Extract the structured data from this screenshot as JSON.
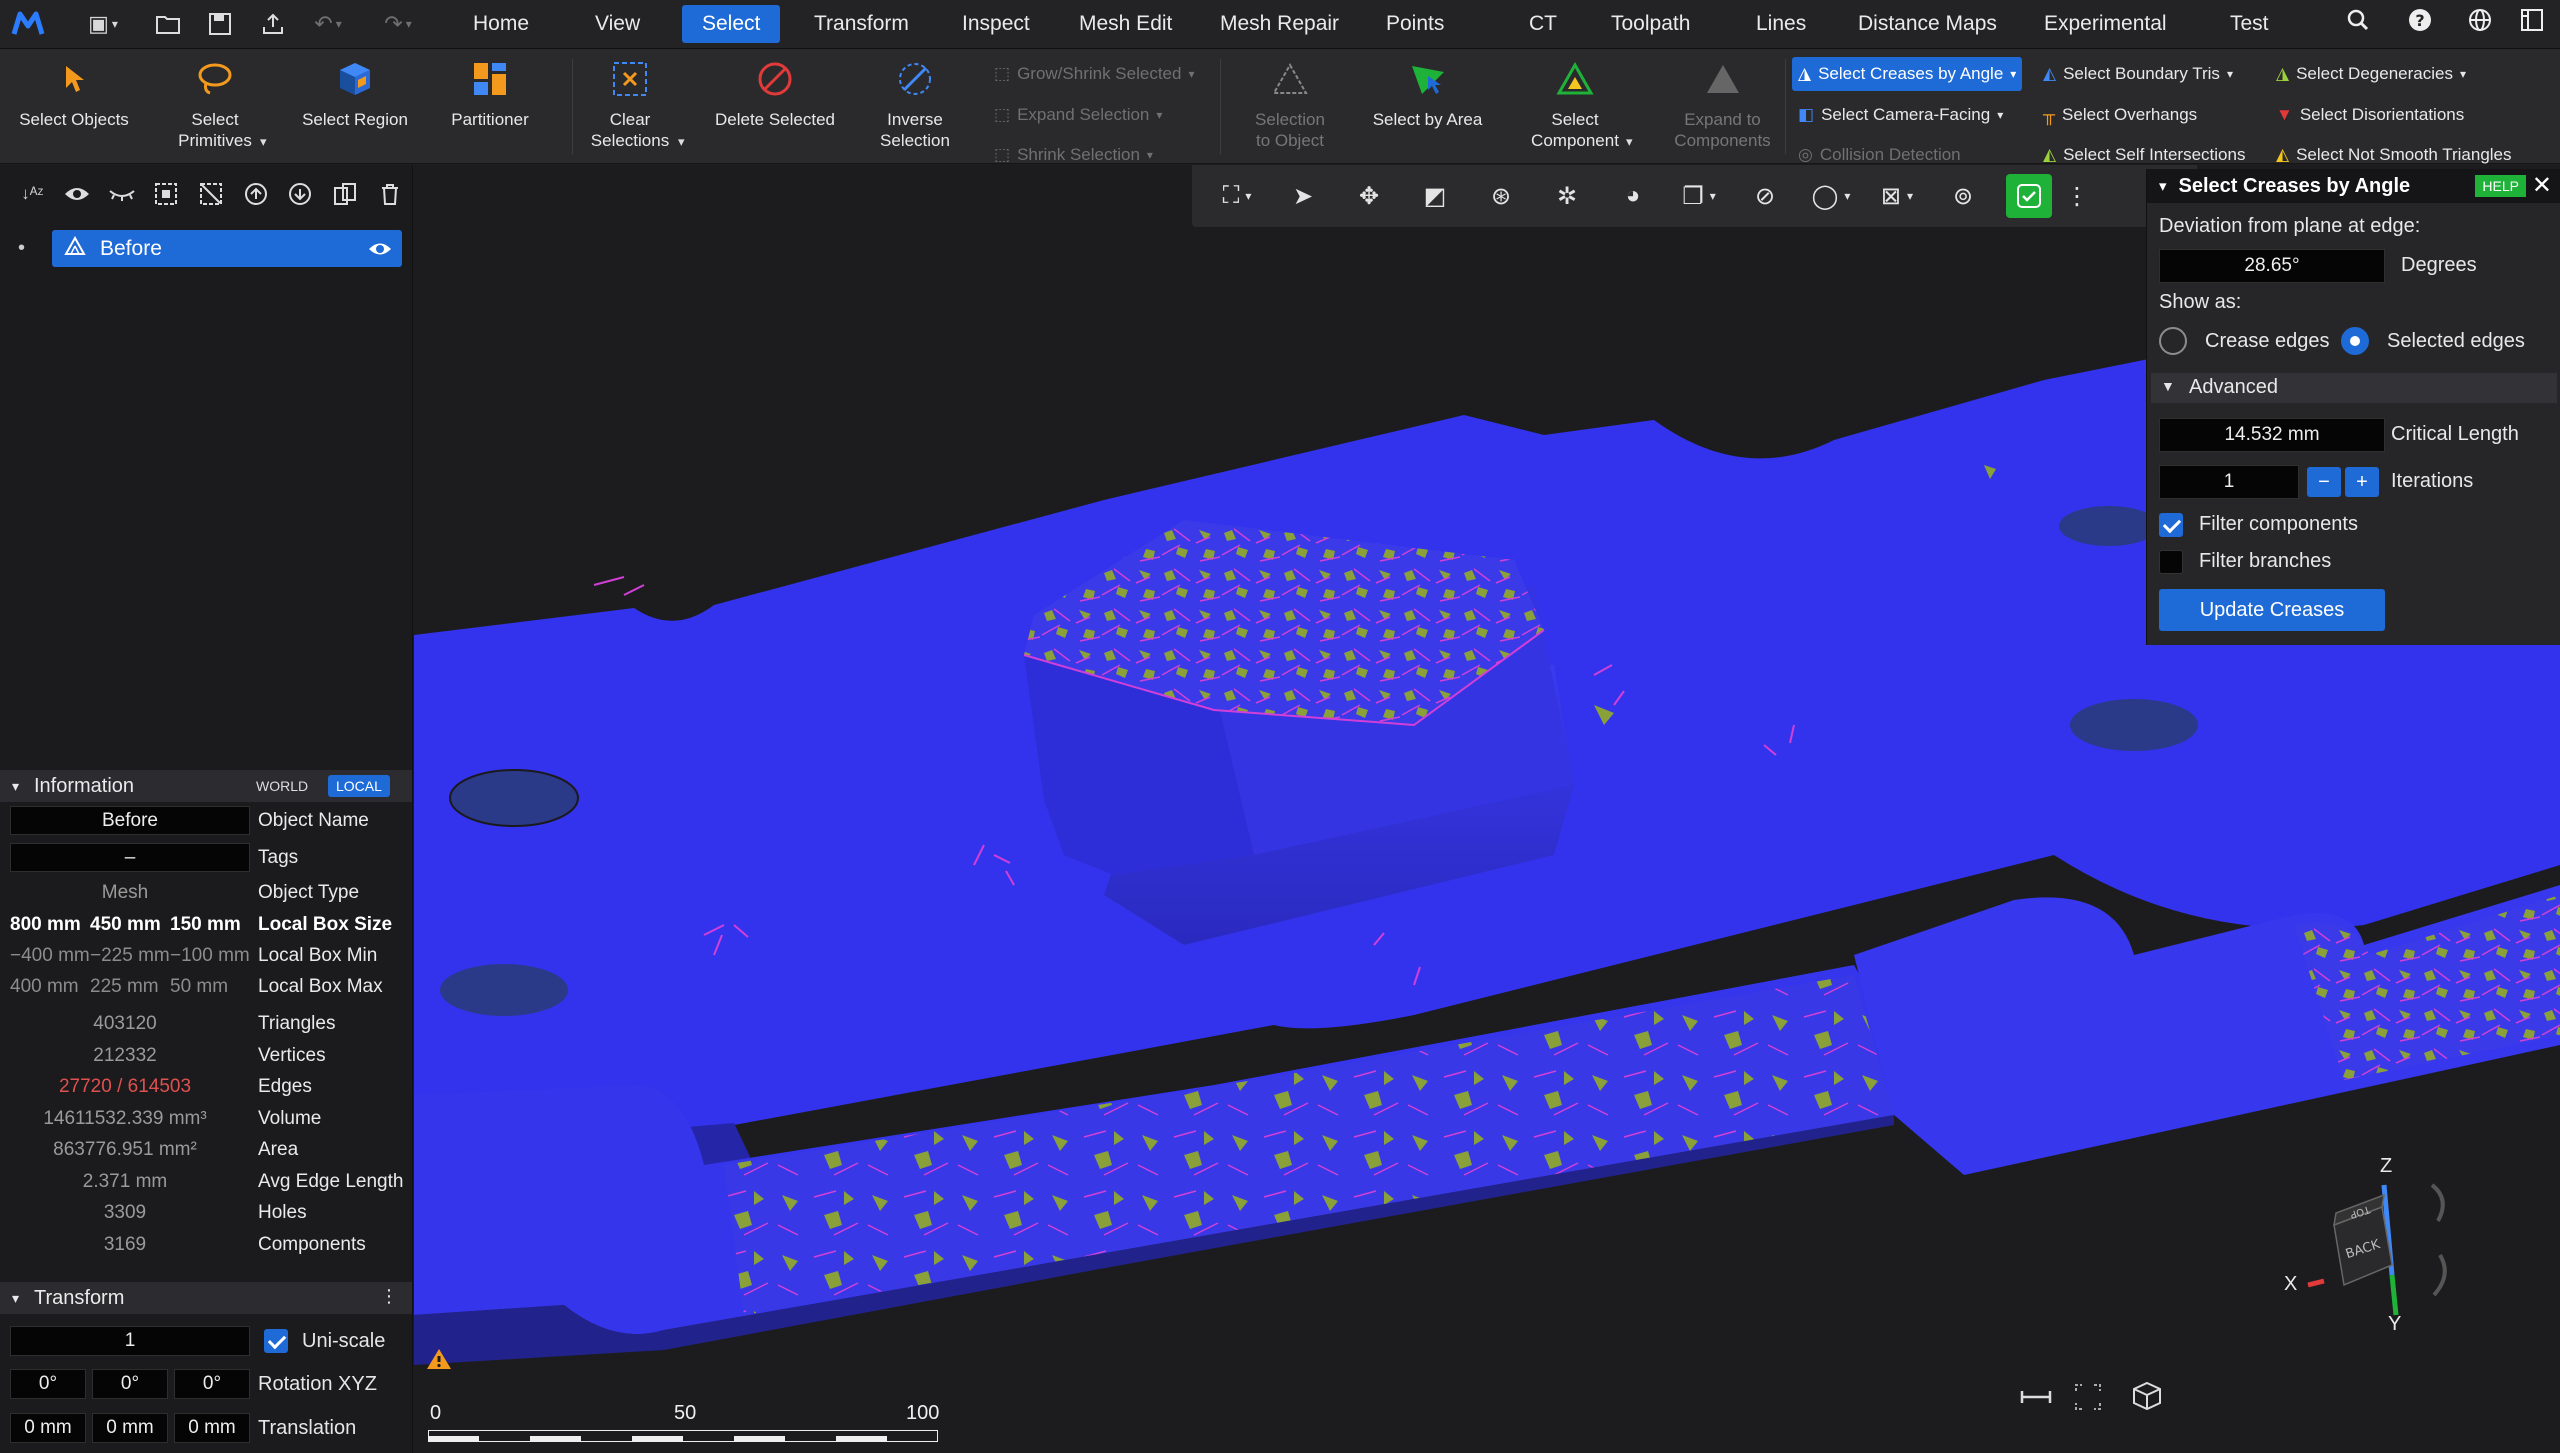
{
  "app": {
    "logo": "app-logo"
  },
  "quick_access": [
    "new-file-icon",
    "open-icon",
    "save-icon",
    "export-icon",
    "undo-icon",
    "redo-icon"
  ],
  "menu": {
    "items": [
      "Home",
      "View",
      "Select",
      "Transform",
      "Inspect",
      "Mesh Edit",
      "Mesh Repair",
      "Points",
      "CT",
      "Toolpath",
      "Lines",
      "Distance Maps",
      "Experimental",
      "Test"
    ],
    "active": "Select"
  },
  "ribbon": {
    "select_objects": "Select Objects",
    "select_primitives": "Select\nPrimitives",
    "select_region": "Select Region",
    "partitioner": "Partitioner",
    "clear_selections": "Clear\nSelections",
    "delete_selected": "Delete Selected",
    "inverse_selection": "Inverse\nSelection",
    "grow_shrink": "Grow/Shrink Selected",
    "expand_selection": "Expand Selection",
    "shrink_selection": "Shrink Selection",
    "selection_to_object": "Selection\nto Object",
    "select_by_area": "Select by Area",
    "select_component": "Select\nComponent",
    "expand_to_components": "Expand to\nComponents",
    "select_creases_by_angle": "Select Creases by Angle",
    "select_camera_facing": "Select Camera-Facing",
    "collision_detection": "Collision Detection",
    "select_boundary_tris": "Select Boundary Tris",
    "select_overhangs": "Select Overhangs",
    "select_self_intersections": "Select Self Intersections",
    "select_degeneracies": "Select Degeneracies",
    "select_disorientations": "Select Disorientations",
    "select_not_smooth_triangles": "Select Not Smooth Triangles"
  },
  "scene_tree": {
    "items": [
      {
        "name": "Before",
        "visible": true
      }
    ]
  },
  "information": {
    "title": "Information",
    "world": "WORLD",
    "local": "LOCAL",
    "object_name": {
      "value": "Before",
      "key": "Object Name"
    },
    "tags": {
      "value": "–",
      "key": "Tags"
    },
    "object_type": {
      "value": "Mesh",
      "key": "Object Type"
    },
    "local_box_size": {
      "values": [
        "800 mm",
        "450 mm",
        "150 mm"
      ],
      "key": "Local Box Size"
    },
    "local_box_min": {
      "values": [
        "−400 mm",
        "−225 mm",
        "−100 mm"
      ],
      "key": "Local Box Min"
    },
    "local_box_max": {
      "values": [
        "400 mm",
        "225 mm",
        "50 mm"
      ],
      "key": "Local Box Max"
    },
    "triangles": {
      "value": "403120",
      "key": "Triangles"
    },
    "vertices": {
      "value": "212332",
      "key": "Vertices"
    },
    "edges": {
      "value": "27720 / 614503",
      "key": "Edges"
    },
    "volume": {
      "value": "14611532.339 mm³",
      "key": "Volume"
    },
    "area": {
      "value": "863776.951 mm²",
      "key": "Area"
    },
    "avg_edge_length": {
      "value": "2.371 mm",
      "key": "Avg Edge Length"
    },
    "holes": {
      "value": "3309",
      "key": "Holes"
    },
    "components": {
      "value": "3169",
      "key": "Components"
    }
  },
  "transform": {
    "title": "Transform",
    "uniscale_value": "1",
    "uniscale_label": "Uni-scale",
    "uniscale_checked": true,
    "rotation": [
      "0°",
      "0°",
      "0°"
    ],
    "rotation_label": "Rotation XYZ",
    "translation": [
      "0 mm",
      "0 mm",
      "0 mm"
    ],
    "translation_label": "Translation"
  },
  "crease_panel": {
    "title": "Select Creases by Angle",
    "help": "HELP",
    "deviation_label": "Deviation from plane at edge:",
    "deviation_value": "28.65°",
    "deviation_unit": "Degrees",
    "show_as_label": "Show as:",
    "option_crease": "Crease edges",
    "option_selected": "Selected edges",
    "show_as_selected": "Selected edges",
    "advanced": "Advanced",
    "critical_length_value": "14.532 mm",
    "critical_length_label": "Critical Length",
    "iterations_value": "1",
    "iterations_label": "Iterations",
    "filter_components": "Filter components",
    "filter_components_checked": true,
    "filter_branches": "Filter branches",
    "filter_branches_checked": false,
    "update_button": "Update Creases"
  },
  "scale_bar": {
    "labels": [
      "0",
      "50",
      "100"
    ]
  },
  "nav_cube": {
    "z": "Z",
    "x": "X",
    "y": "Y",
    "top": "TOP",
    "back": "BACK"
  },
  "colors": {
    "accent": "#1e6ad6",
    "mesh": "#3333ee",
    "selection_green": "#8aa13a",
    "crease_magenta": "#d23fd8",
    "edges_error": "#e05050"
  }
}
